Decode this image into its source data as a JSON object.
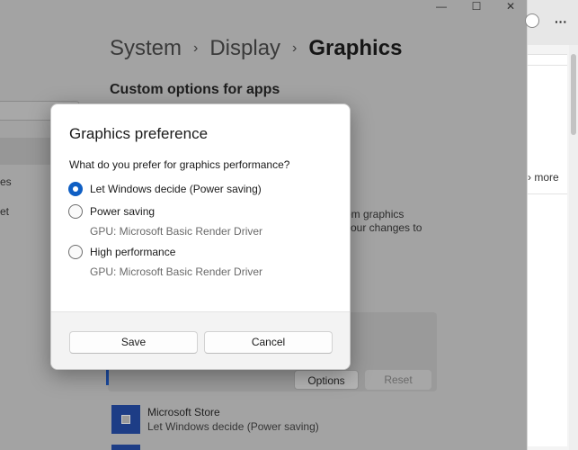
{
  "window": {
    "minimize_glyph": "—",
    "maximize_glyph": "☐",
    "close_glyph": "✕"
  },
  "breadcrumb": {
    "items": [
      "System",
      "Display",
      "Graphics"
    ],
    "separator": "›"
  },
  "section_title": "Custom options for apps",
  "left_nav": {
    "item1": "es",
    "item2": "et"
  },
  "background_text": {
    "line1": "om graphics",
    "line2": "your changes to"
  },
  "app_card": {
    "options_label": "Options",
    "reset_label": "Reset"
  },
  "app_list": [
    {
      "name": "Microsoft Store",
      "preference": "Let Windows decide (Power saving)"
    }
  ],
  "browser": {
    "menu_glyph": "···",
    "more_text": "› more"
  },
  "dialog": {
    "title": "Graphics preference",
    "question": "What do you prefer for graphics performance?",
    "options": [
      {
        "label": "Let Windows decide (Power saving)",
        "checked": true,
        "gpu": ""
      },
      {
        "label": "Power saving",
        "checked": false,
        "gpu": "GPU: Microsoft Basic Render Driver"
      },
      {
        "label": "High performance",
        "checked": false,
        "gpu": "GPU: Microsoft Basic Render Driver"
      }
    ],
    "save_label": "Save",
    "cancel_label": "Cancel"
  },
  "colors": {
    "accent": "#0f5fc4",
    "overlay": "#a3a3a3",
    "store_icon": "#1d3d86"
  }
}
